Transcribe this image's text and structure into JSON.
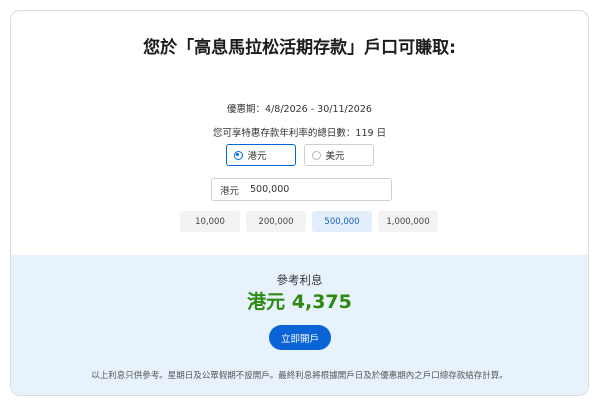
{
  "title": "您於「高息馬拉松活期存款」戶口可賺取:",
  "promo_period": "優惠期：4/8/2026 - 30/11/2026",
  "promo_days": "您可享特惠存款年利率的總日數：119 日",
  "currency_options": [
    {
      "label": "港元",
      "selected": true
    },
    {
      "label": "美元",
      "selected": false
    }
  ],
  "amount_input": {
    "prefix": "港元",
    "value": "500,000"
  },
  "presets": [
    "10,000",
    "200,000",
    "500,000",
    "1,000,000"
  ],
  "active_preset": "500,000",
  "reference": {
    "label": "參考利息",
    "value": "港元 4,375"
  },
  "open_button_label": "立即開戶",
  "disclaimer": "以上利息只供參考。星期日及公眾假期不設開戶。最終利息將根據開戶日及於優惠期內之戶口總存款結存計算。",
  "colors": {
    "accent": "#0b64d6",
    "interest_green": "#2b8a0f",
    "bottom_panel": "#e8f2fc"
  }
}
